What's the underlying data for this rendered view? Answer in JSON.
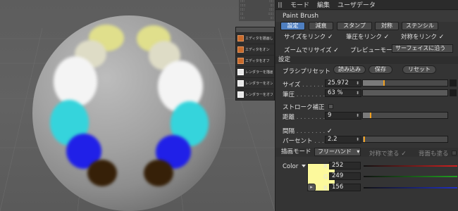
{
  "menubar": {
    "items": [
      "モード",
      "編集",
      "ユーザデータ"
    ]
  },
  "tool": {
    "name": "Paint Brush"
  },
  "tabs": [
    "設定",
    "減衰",
    "スタンプ",
    "対称",
    "ステンシル"
  ],
  "link": {
    "size": "サイズをリンク",
    "pressure": "筆圧をリンク",
    "symmetry": "対称をリンク",
    "check": "✓"
  },
  "zoom": {
    "label": "ズームでリサイズ",
    "preview_label": "プレビューモード",
    "preview_value": "サーフェイスに沿う"
  },
  "settings": {
    "section": "設定",
    "preset_label": "ブラシプリセット",
    "load": "読み込み",
    "save": "保存",
    "reset": "リセット",
    "size_label": "サイズ",
    "size_value": "25.972",
    "size_fraction": 0.25,
    "pressure_label": "筆圧",
    "pressure_value": "63 %",
    "stroke_label": "ストローク補正",
    "distance_label": "距離",
    "distance_value": "9",
    "distance_fraction": 0.09,
    "interval_label": "間隔",
    "percent_label": "パーセント",
    "percent_value": "2.2",
    "percent_fraction": 0.02
  },
  "paint": {
    "mode_label": "描画モード",
    "mode_value": "フリーハンド",
    "symmetric": "対称で塗る",
    "backface": "背面も塗る",
    "color_label": "Color",
    "r_label": "R",
    "r_value": "252",
    "g_label": "G",
    "g_value": "249",
    "b_label": "B",
    "b_value": "156",
    "swatch_color": "#fcf99c"
  },
  "float_panel": {
    "items": [
      "エディタを描画しない",
      "エディタをオン",
      "エディタをオフ",
      "レンダラーを描画しない",
      "レンダラーをオン",
      "レンダラーをオフ"
    ]
  },
  "colors": {
    "accent": "#4f7fc0",
    "slider_marker": "#f0a020"
  }
}
